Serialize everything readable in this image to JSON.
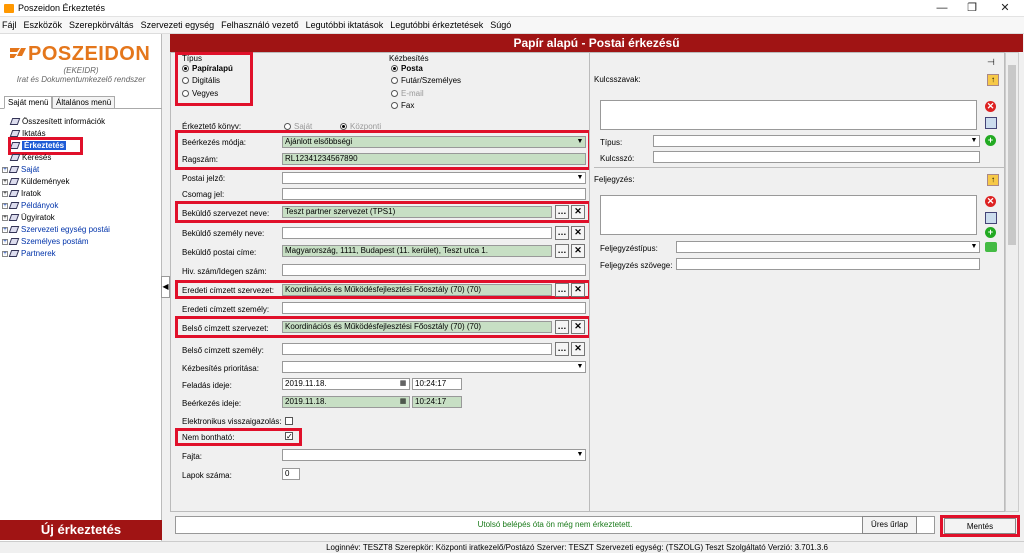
{
  "window": {
    "title": "Poszeidon Érkeztetés",
    "min": "—",
    "max": "❐",
    "close": "✕"
  },
  "menu": [
    "Fájl",
    "Eszközök",
    "Szerepkörváltás",
    "Szervezeti egység",
    "Felhasználó vezető",
    "Legutóbbi iktatások",
    "Legutóbbi érkeztetések",
    "Súgó"
  ],
  "logo": {
    "name": "POSZEIDON",
    "sub1": "(EKEIDR)",
    "sub2": "Irat és Dokumentumkezelő rendszer"
  },
  "left_tabs": [
    "Saját menü",
    "Általános menü"
  ],
  "tree": [
    {
      "label": "Összesített információk",
      "expander": "",
      "blue": false
    },
    {
      "label": "Iktatás",
      "expander": "",
      "blue": false
    },
    {
      "label": "Érkeztetés",
      "expander": "",
      "blue": false,
      "selected": true
    },
    {
      "label": "Keresés",
      "expander": "",
      "blue": false
    },
    {
      "label": "Saját",
      "expander": "+",
      "blue": true
    },
    {
      "label": "Küldemények",
      "expander": "+",
      "blue": false
    },
    {
      "label": "Iratok",
      "expander": "+",
      "blue": false
    },
    {
      "label": "Példányok",
      "expander": "+",
      "blue": true
    },
    {
      "label": "Ügyiratok",
      "expander": "+",
      "blue": false
    },
    {
      "label": "Szervezeti egység postái",
      "expander": "+",
      "blue": true
    },
    {
      "label": "Személyes postám",
      "expander": "+",
      "blue": true
    },
    {
      "label": "Partnerek",
      "expander": "+",
      "blue": true
    }
  ],
  "new_button": "Új érkeztetés",
  "header": "Papír alapú - Postai érkezésű",
  "tipus": {
    "title": "Típus",
    "options": [
      "Papíralapú",
      "Digitális",
      "Vegyes"
    ],
    "selected": 0
  },
  "kezbesites": {
    "title": "Kézbesítés",
    "options": [
      "Posta",
      "Futár/Személyes",
      "E-mail",
      "Fax"
    ],
    "selected": 0
  },
  "erkezteto_konyv": {
    "label": "Érkeztető könyv:",
    "options": [
      "Saját",
      "Központi"
    ]
  },
  "fields": {
    "beerkezes_modja": {
      "label": "Beérkezés módja:",
      "value": "Ajánlott elsőbbségi"
    },
    "ragszam": {
      "label": "Ragszám:",
      "value": "RL12341234567890"
    },
    "postai_jelzo": {
      "label": "Postai jelző:",
      "value": ""
    },
    "csomag_jel": {
      "label": "Csomag jel:",
      "value": ""
    },
    "bekuldo_szervezet": {
      "label": "Beküldő szervezet neve:",
      "value": "Teszt partner szervezet (TPS1)"
    },
    "bekuldo_szemely": {
      "label": "Beküldő személy neve:",
      "value": ""
    },
    "bekuldo_cim": {
      "label": "Beküldő postai címe:",
      "value": "Magyarország, 1111, Budapest (11. kerület), Teszt utca 1."
    },
    "hiv_szam": {
      "label": "Hiv. szám/Idegen szám:",
      "value": ""
    },
    "eredeti_cimzett_szervezet": {
      "label": "Eredeti címzett szervezet:",
      "value": "Koordinációs és Működésfejlesztési Főosztály (70) (70)"
    },
    "eredeti_cimzett_szemely": {
      "label": "Eredeti címzett személy:",
      "value": ""
    },
    "belso_cimzett_szervezet": {
      "label": "Belső címzett szervezet:",
      "value": "Koordinációs és Működésfejlesztési Főosztály (70) (70)"
    },
    "belso_cimzett_szemely": {
      "label": "Belső címzett személy:",
      "value": ""
    },
    "kezbesites_prioritasa": {
      "label": "Kézbesítés prioritása:",
      "value": ""
    },
    "feladas_ideje": {
      "label": "Feladás ideje:",
      "date": "2019.11.18.",
      "time": "10:24:17"
    },
    "beerkezes_ideje": {
      "label": "Beérkezés ideje:",
      "date": "2019.11.18.",
      "time": "10:24:17"
    },
    "elektronikus": {
      "label": "Elektronikus visszaigazolás:",
      "checked": false
    },
    "nem_bonthato": {
      "label": "Nem bontható:",
      "checked": true
    },
    "fajta": {
      "label": "Fajta:",
      "value": ""
    },
    "lapok_szama": {
      "label": "Lapok száma:",
      "value": "0"
    }
  },
  "right": {
    "kulcsszavak": "Kulcsszavak:",
    "tipus": "Típus:",
    "kulcsszo": "Kulcsszó:",
    "feljegyzes": "Feljegyzés:",
    "feljegyzes_tipus": "Feljegyzéstípus:",
    "feljegyzes_szovege": "Feljegyzés szövege:"
  },
  "message": "Utolsó belépés óta ön még nem érkeztetett.",
  "buttons": {
    "ures_urlap": "Üres űrlap",
    "mentes": "Mentés"
  },
  "status": "Loginnév: TESZT8   Szerepkör: Központi iratkezelő/Postázó   Szerver: TESZT   Szervezeti egység: (TSZOLG) Teszt Szolgáltató   Verzió: 3.701.3.6",
  "colors": {
    "header": "#a01414",
    "highlight": "#e0102a",
    "green_field": "#c7dfc4",
    "logo": "#e4761b"
  }
}
